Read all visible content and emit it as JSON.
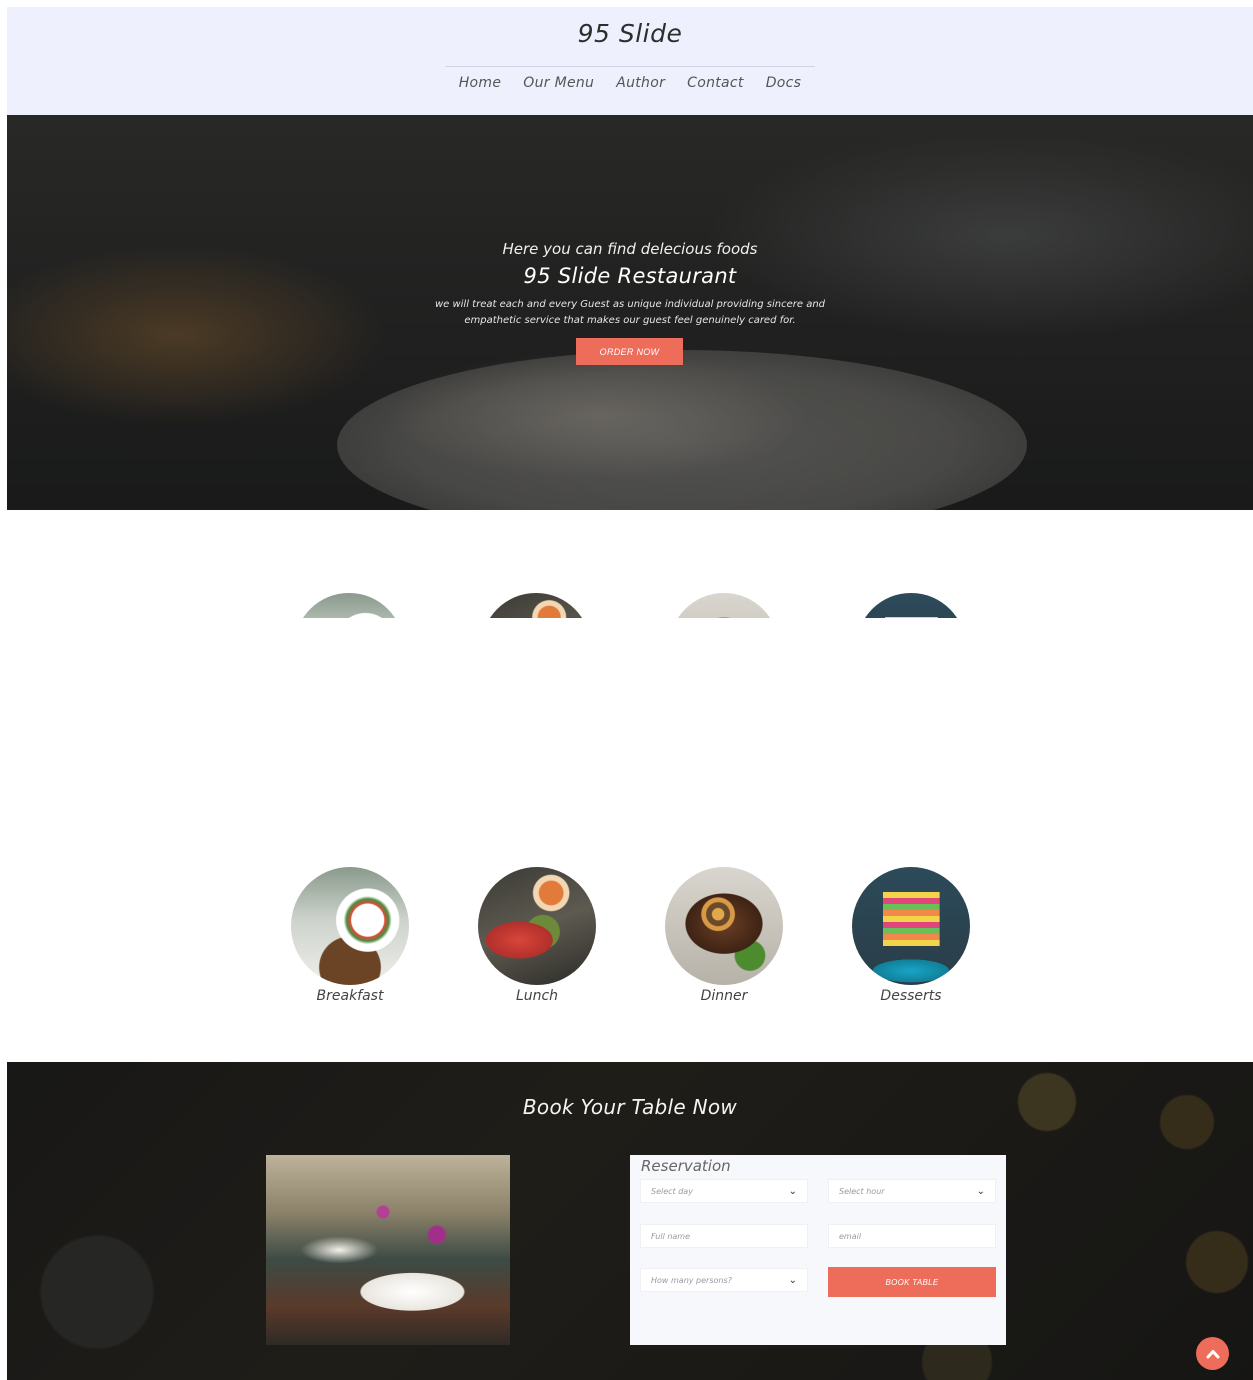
{
  "header": {
    "brand": "95 Slide",
    "nav": [
      "Home",
      "Our Menu",
      "Author",
      "Contact",
      "Docs"
    ]
  },
  "hero": {
    "tagline": "Here you can find delecious foods",
    "title": "95 Slide Restaurant",
    "description": "we will treat each and every Guest as unique individual providing sincere and empathetic service that makes our guest feel genuinely cared for.",
    "cta": "ORDER NOW"
  },
  "categories": [
    {
      "label": "Breakfast"
    },
    {
      "label": "Lunch"
    },
    {
      "label": "Dinner"
    },
    {
      "label": "Desserts"
    }
  ],
  "booking": {
    "heading": "Book Your Table Now",
    "legend": "Reservation",
    "day_placeholder": "Select day",
    "hour_placeholder": "Select hour",
    "name_placeholder": "Full name",
    "email_placeholder": "email",
    "persons_placeholder": "How many persons?",
    "submit": "BOOK TABLE"
  },
  "colors": {
    "accent": "#ee6d5a",
    "header_bg": "#eef1fd"
  },
  "icons": {
    "scroll_top": "chevron-up-icon",
    "select_caret": "chevron-down-icon"
  }
}
